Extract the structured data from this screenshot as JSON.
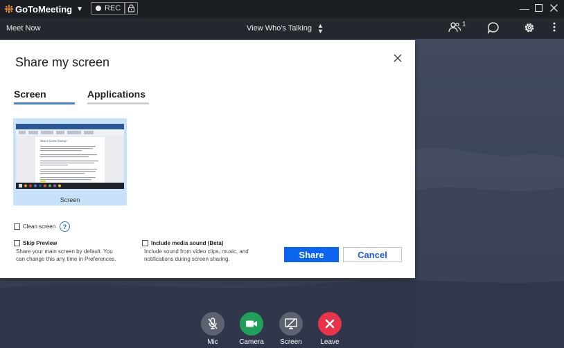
{
  "app": {
    "brand": "GoToMeeting",
    "rec_label": "REC"
  },
  "toolbar": {
    "meet_now": "Meet Now",
    "view_mode": "View Who's Talking",
    "attendee_count": "1"
  },
  "dialog": {
    "title": "Share my screen",
    "tabs": [
      {
        "label": "Screen",
        "active": true
      },
      {
        "label": "Applications",
        "active": false
      }
    ],
    "screen_thumb_label": "Screen",
    "thumb_doc_title": "What is Screen Sharing?",
    "clean_screen_label": "Clean screen",
    "skip_preview": {
      "title": "Skip Preview",
      "desc_line1": "Share your main screen by default. You",
      "desc_line2": "can change this any time in Preferences."
    },
    "media_sound": {
      "title": "Include media sound (Beta)",
      "desc_line1": "Include sound from video clips, music, and",
      "desc_line2": "notifications during screen sharing."
    },
    "share_button": "Share",
    "cancel_button": "Cancel"
  },
  "controls": [
    {
      "label": "Mic",
      "color": "#5c6270"
    },
    {
      "label": "Camera",
      "color": "#1fa15b"
    },
    {
      "label": "Screen",
      "color": "#5c6270"
    },
    {
      "label": "Leave",
      "color": "#e8344a"
    }
  ],
  "colors": {
    "accent": "#0a64f0",
    "tab_active": "#4a7fd0",
    "brand_orange": "#f68b1f"
  }
}
